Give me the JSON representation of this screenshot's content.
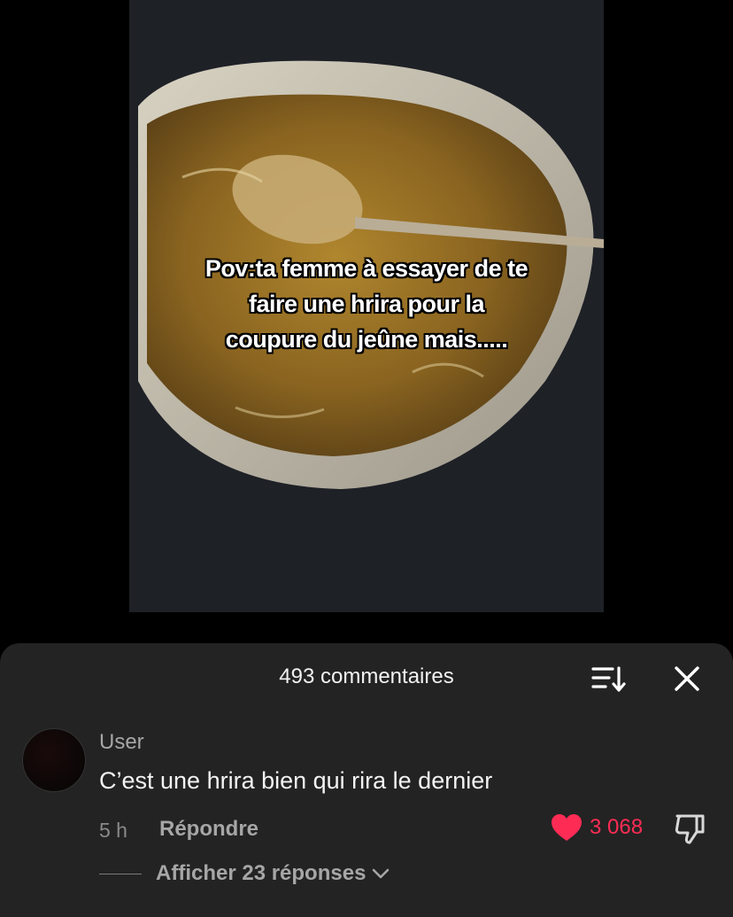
{
  "video": {
    "overlay_text": "Pov:ta femme à essayer de te\nfaire une hrira pour la\ncoupure du jeûne mais....."
  },
  "comments_sheet": {
    "title": "493 commentaires",
    "sort_icon": "sort-icon",
    "close_icon": "close-icon"
  },
  "comment": {
    "author": "User",
    "text": "C’est une hrira bien qui rira le dernier",
    "time": "5 h",
    "reply_label": "Répondre",
    "like_count": "3 068",
    "liked": true,
    "like_color": "#fe2c55",
    "view_replies_label": "Afficher 23 réponses"
  }
}
